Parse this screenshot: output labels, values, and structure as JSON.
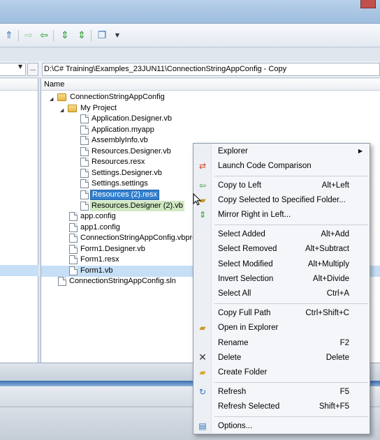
{
  "path_bar": {
    "left_dots": "...",
    "right_path": "D:\\C# Training\\Examples_23JUN11\\ConnectionStringAppConfig - Copy"
  },
  "right_pane": {
    "column_header": "Name",
    "rows": [
      {
        "label": "ConnectionStringAppConfig"
      },
      {
        "label": "My Project"
      },
      {
        "label": "Application.Designer.vb"
      },
      {
        "label": "Application.myapp"
      },
      {
        "label": "AssemblyInfo.vb"
      },
      {
        "label": "Resources.Designer.vb"
      },
      {
        "label": "Resources.resx"
      },
      {
        "label": "Settings.Designer.vb"
      },
      {
        "label": "Settings.settings"
      },
      {
        "label": "Resources (2).resx"
      },
      {
        "label": "Resources.Designer (2).vb"
      },
      {
        "label": "app.config"
      },
      {
        "label": "app1.config"
      },
      {
        "label": "ConnectionStringAppConfig.vbproj"
      },
      {
        "label": "Form1.Designer.vb"
      },
      {
        "label": "Form1.resx"
      },
      {
        "label": "Form1.vb"
      },
      {
        "label": "ConnectionStringAppConfig.sln"
      }
    ]
  },
  "context_menu": {
    "items": [
      {
        "label": "Explorer",
        "shortcut": "",
        "icon": ""
      },
      {
        "label": "Launch Code Comparison",
        "shortcut": "",
        "icon": "compare-icon"
      },
      {
        "label": "Copy to Left",
        "shortcut": "Alt+Left",
        "icon": "arrow-left-icon"
      },
      {
        "label": "Copy Selected to Specified Folder...",
        "shortcut": "",
        "icon": "folder-copy-icon"
      },
      {
        "label": "Mirror Right in Left...",
        "shortcut": "",
        "icon": "mirror-icon"
      },
      {
        "label": "Select Added",
        "shortcut": "Alt+Add",
        "icon": ""
      },
      {
        "label": "Select Removed",
        "shortcut": "Alt+Subtract",
        "icon": ""
      },
      {
        "label": "Select Modified",
        "shortcut": "Alt+Multiply",
        "icon": ""
      },
      {
        "label": "Invert Selection",
        "shortcut": "Alt+Divide",
        "icon": ""
      },
      {
        "label": "Select All",
        "shortcut": "Ctrl+A",
        "icon": ""
      },
      {
        "label": "Copy Full Path",
        "shortcut": "Ctrl+Shift+C",
        "icon": ""
      },
      {
        "label": "Open in Explorer",
        "shortcut": "",
        "icon": "open-explorer-icon"
      },
      {
        "label": "Rename",
        "shortcut": "F2",
        "icon": ""
      },
      {
        "label": "Delete",
        "shortcut": "Delete",
        "icon": "delete-x-icon"
      },
      {
        "label": "Create Folder",
        "shortcut": "",
        "icon": "new-folder-icon"
      },
      {
        "label": "Refresh",
        "shortcut": "F5",
        "icon": "refresh-icon"
      },
      {
        "label": "Refresh Selected",
        "shortcut": "Shift+F5",
        "icon": ""
      },
      {
        "label": "Options...",
        "shortcut": "",
        "icon": "options-icon"
      }
    ]
  }
}
